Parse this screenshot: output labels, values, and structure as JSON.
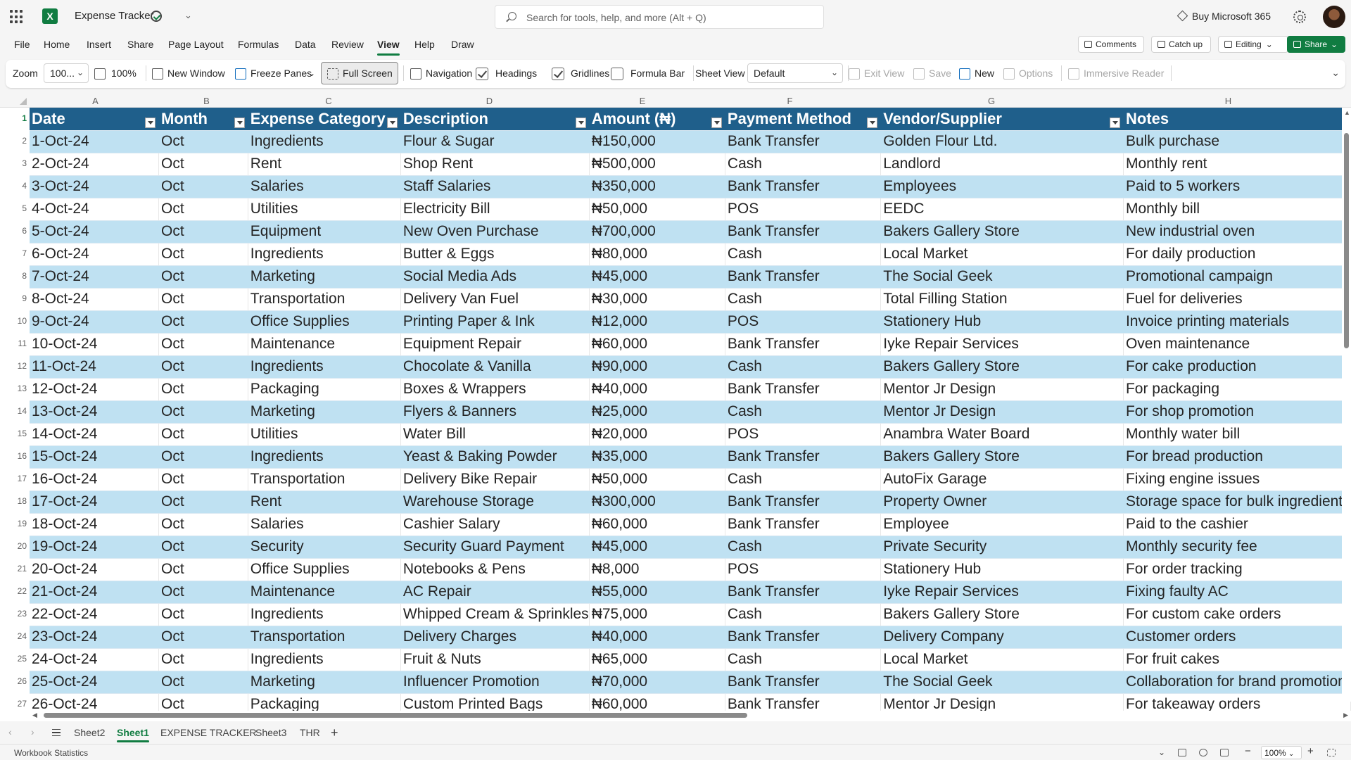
{
  "titlebar": {
    "doc_title": "Expense Tracker",
    "search_placeholder": "Search for tools, help, and more (Alt + Q)",
    "buy_label": "Buy Microsoft 365"
  },
  "menu": {
    "items": [
      "File",
      "Home",
      "Insert",
      "Share",
      "Page Layout",
      "Formulas",
      "Data",
      "Review",
      "View",
      "Help",
      "Draw"
    ],
    "active": "View",
    "comments_label": "Comments",
    "catchup_label": "Catch up",
    "editing_label": "Editing",
    "share_label": "Share"
  },
  "ribbon": {
    "zoom_label": "Zoom",
    "zoom_value": "100...",
    "zoom100_label": "100%",
    "new_window_label": "New Window",
    "freeze_panes_label": "Freeze Panes",
    "full_screen_label": "Full Screen",
    "navigation_label": "Navigation",
    "headings_label": "Headings",
    "headings_checked": true,
    "gridlines_label": "Gridlines",
    "gridlines_checked": true,
    "formula_bar_label": "Formula Bar",
    "formula_bar_checked": false,
    "sheet_view_label": "Sheet View",
    "sheet_view_value": "Default",
    "exit_view_label": "Exit View",
    "save_label": "Save",
    "new_label": "New",
    "options_label": "Options",
    "immersive_reader_label": "Immersive Reader"
  },
  "sheet": {
    "column_letters": [
      "A",
      "B",
      "C",
      "D",
      "E",
      "F",
      "G",
      "H"
    ],
    "headers": [
      "Date",
      "Month",
      "Expense Category",
      "Description",
      "Amount (₦)",
      "Payment Method",
      "Vendor/Supplier",
      "Notes"
    ],
    "rows": [
      [
        "1-Oct-24",
        "Oct",
        "Ingredients",
        "Flour & Sugar",
        "₦150,000",
        "Bank Transfer",
        "Golden Flour Ltd.",
        "Bulk purchase"
      ],
      [
        "2-Oct-24",
        "Oct",
        "Rent",
        "Shop Rent",
        "₦500,000",
        "Cash",
        "Landlord",
        "Monthly rent"
      ],
      [
        "3-Oct-24",
        "Oct",
        "Salaries",
        "Staff Salaries",
        "₦350,000",
        "Bank Transfer",
        "Employees",
        "Paid to 5 workers"
      ],
      [
        "4-Oct-24",
        "Oct",
        "Utilities",
        "Electricity Bill",
        "₦50,000",
        "POS",
        "EEDC",
        "Monthly bill"
      ],
      [
        "5-Oct-24",
        "Oct",
        "Equipment",
        "New Oven Purchase",
        "₦700,000",
        "Bank Transfer",
        "Bakers Gallery Store",
        "New industrial oven"
      ],
      [
        "6-Oct-24",
        "Oct",
        "Ingredients",
        "Butter & Eggs",
        "₦80,000",
        "Cash",
        "Local Market",
        "For daily production"
      ],
      [
        "7-Oct-24",
        "Oct",
        "Marketing",
        "Social Media Ads",
        "₦45,000",
        "Bank Transfer",
        "The Social Geek",
        "Promotional campaign"
      ],
      [
        "8-Oct-24",
        "Oct",
        "Transportation",
        "Delivery Van Fuel",
        "₦30,000",
        "Cash",
        "Total Filling Station",
        "Fuel for deliveries"
      ],
      [
        "9-Oct-24",
        "Oct",
        "Office Supplies",
        "Printing Paper & Ink",
        "₦12,000",
        "POS",
        "Stationery Hub",
        "Invoice printing materials"
      ],
      [
        "10-Oct-24",
        "Oct",
        "Maintenance",
        "Equipment Repair",
        "₦60,000",
        "Bank Transfer",
        "Iyke Repair Services",
        "Oven maintenance"
      ],
      [
        "11-Oct-24",
        "Oct",
        "Ingredients",
        "Chocolate & Vanilla",
        "₦90,000",
        "Cash",
        "Bakers Gallery Store",
        "For cake production"
      ],
      [
        "12-Oct-24",
        "Oct",
        "Packaging",
        "Boxes & Wrappers",
        "₦40,000",
        "Bank Transfer",
        "Mentor Jr Design",
        "For packaging"
      ],
      [
        "13-Oct-24",
        "Oct",
        "Marketing",
        "Flyers & Banners",
        "₦25,000",
        "Cash",
        "Mentor Jr Design",
        "For shop promotion"
      ],
      [
        "14-Oct-24",
        "Oct",
        "Utilities",
        "Water Bill",
        "₦20,000",
        "POS",
        "Anambra Water Board",
        "Monthly water bill"
      ],
      [
        "15-Oct-24",
        "Oct",
        "Ingredients",
        "Yeast & Baking Powder",
        "₦35,000",
        "Bank Transfer",
        "Bakers Gallery Store",
        "For bread production"
      ],
      [
        "16-Oct-24",
        "Oct",
        "Transportation",
        "Delivery Bike Repair",
        "₦50,000",
        "Cash",
        "AutoFix Garage",
        "Fixing engine issues"
      ],
      [
        "17-Oct-24",
        "Oct",
        "Rent",
        "Warehouse Storage",
        "₦300,000",
        "Bank Transfer",
        "Property Owner",
        "Storage space for bulk ingredients"
      ],
      [
        "18-Oct-24",
        "Oct",
        "Salaries",
        "Cashier Salary",
        "₦60,000",
        "Bank Transfer",
        "Employee",
        "Paid to the cashier"
      ],
      [
        "19-Oct-24",
        "Oct",
        "Security",
        "Security Guard Payment",
        "₦45,000",
        "Cash",
        "Private Security",
        "Monthly security fee"
      ],
      [
        "20-Oct-24",
        "Oct",
        "Office Supplies",
        "Notebooks & Pens",
        "₦8,000",
        "POS",
        "Stationery Hub",
        "For order tracking"
      ],
      [
        "21-Oct-24",
        "Oct",
        "Maintenance",
        "AC Repair",
        "₦55,000",
        "Bank Transfer",
        "Iyke Repair Services",
        "Fixing faulty AC"
      ],
      [
        "22-Oct-24",
        "Oct",
        "Ingredients",
        "Whipped Cream & Sprinkles",
        "₦75,000",
        "Cash",
        "Bakers Gallery Store",
        "For custom cake orders"
      ],
      [
        "23-Oct-24",
        "Oct",
        "Transportation",
        "Delivery Charges",
        "₦40,000",
        "Bank Transfer",
        "Delivery Company",
        "Customer orders"
      ],
      [
        "24-Oct-24",
        "Oct",
        "Ingredients",
        "Fruit & Nuts",
        "₦65,000",
        "Cash",
        "Local Market",
        "For fruit cakes"
      ],
      [
        "25-Oct-24",
        "Oct",
        "Marketing",
        "Influencer Promotion",
        "₦70,000",
        "Bank Transfer",
        "The Social Geek",
        "Collaboration for brand promotion"
      ],
      [
        "26-Oct-24",
        "Oct",
        "Packaging",
        "Custom Printed Bags",
        "₦60,000",
        "Bank Transfer",
        "Mentor Jr Design",
        "For takeaway orders"
      ]
    ],
    "band_color": "#bfe1f2",
    "header_color": "#1f5f8b"
  },
  "tabs": {
    "items": [
      "Sheet2",
      "Sheet1",
      "EXPENSE TRACKER",
      "Sheet3",
      "THR"
    ],
    "active": "Sheet1"
  },
  "status": {
    "left_text": "Workbook Statistics",
    "zoom_value": "100%"
  }
}
